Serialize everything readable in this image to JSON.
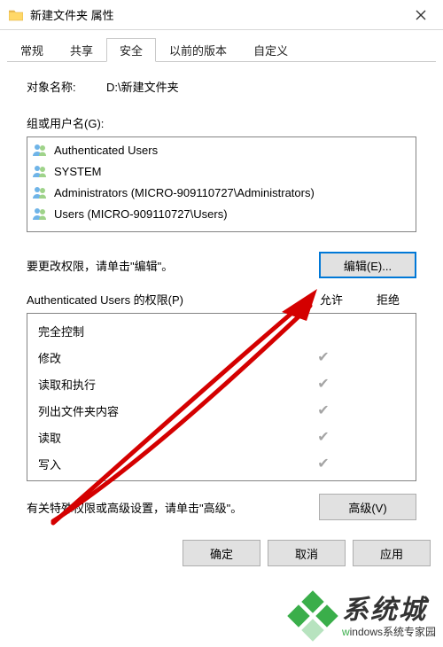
{
  "titlebar": {
    "title": "新建文件夹 属性"
  },
  "tabs": {
    "t0": "常规",
    "t1": "共享",
    "t2": "安全",
    "t3": "以前的版本",
    "t4": "自定义"
  },
  "security": {
    "object_label": "对象名称:",
    "object_value": "D:\\新建文件夹",
    "group_label": "组或用户名(G):",
    "principals": [
      "Authenticated Users",
      "SYSTEM",
      "Administrators (MICRO-909110727\\Administrators)",
      "Users (MICRO-909110727\\Users)"
    ],
    "edit_hint": "要更改权限，请单击\"编辑\"。",
    "edit_btn": "编辑(E)...",
    "perm_header": "Authenticated Users 的权限(P)",
    "col_allow": "允许",
    "col_deny": "拒绝",
    "perms": {
      "p0": {
        "label": "完全控制",
        "allow": "",
        "deny": ""
      },
      "p1": {
        "label": "修改",
        "allow": "✔",
        "deny": ""
      },
      "p2": {
        "label": "读取和执行",
        "allow": "✔",
        "deny": ""
      },
      "p3": {
        "label": "列出文件夹内容",
        "allow": "✔",
        "deny": ""
      },
      "p4": {
        "label": "读取",
        "allow": "✔",
        "deny": ""
      },
      "p5": {
        "label": "写入",
        "allow": "✔",
        "deny": ""
      }
    },
    "advanced_hint": "有关特殊权限或高级设置，请单击\"高级\"。",
    "advanced_btn": "高级(V)"
  },
  "buttons": {
    "ok": "确定",
    "cancel": "取消",
    "apply": "应用"
  },
  "watermark": {
    "big": "系统城",
    "small_prefix": "w",
    "small_rest": "indows",
    "small_tail": "系统专家园"
  }
}
